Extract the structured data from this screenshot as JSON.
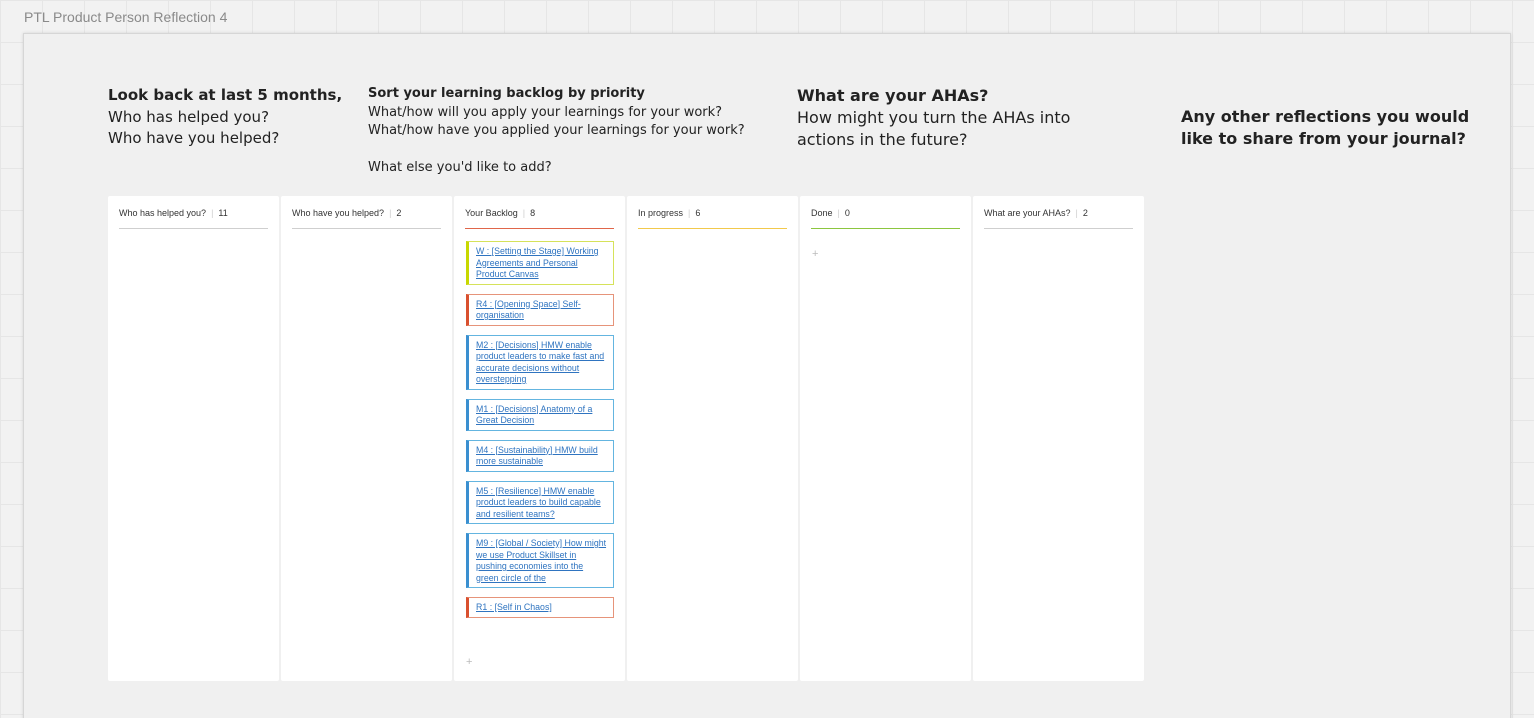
{
  "board": {
    "title": "PTL Product Person Reflection 4"
  },
  "prompts": {
    "p1": {
      "bold": "Look back at last 5 months,",
      "line1": "Who has helped you?",
      "line2": "Who have you helped?"
    },
    "p2": {
      "bold": "Sort your learning backlog by priority",
      "line1": "What/how will you apply your learnings for your work?",
      "line2": "What/how have you applied your learnings for your work?",
      "line3": "What else you'd like to add?"
    },
    "p3": {
      "bold": "What are your AHAs?",
      "line1": "How might you turn the AHAs into",
      "line2": "actions in the future?"
    },
    "p4": {
      "bold1": "Any other reflections you would",
      "bold2": "like to share from your journal?"
    }
  },
  "columns": [
    {
      "title": "Who has helped you?",
      "count": "11"
    },
    {
      "title": "Who have you helped?",
      "count": "2"
    },
    {
      "title": "Your Backlog",
      "count": "8"
    },
    {
      "title": "In progress",
      "count": "6"
    },
    {
      "title": "Done",
      "count": "0"
    },
    {
      "title": "What are your AHAs?",
      "count": "2"
    }
  ],
  "backlog_cards": [
    {
      "text": "W : [Setting the Stage] Working Agreements and Personal Product Canvas",
      "color": "yellow"
    },
    {
      "text": "R4 : [Opening Space] Self-organisation",
      "color": "red"
    },
    {
      "text": "M2 : [Decisions] HMW enable product leaders to make fast and accurate decisions without overstepping",
      "color": "blue"
    },
    {
      "text": "M1 : [Decisions] Anatomy of a Great Decision",
      "color": "blue"
    },
    {
      "text": "M4 : [Sustainability] HMW build more sustainable",
      "color": "blue"
    },
    {
      "text": "M5 : [Resilience] HMW enable product leaders to build capable and resilient teams?",
      "color": "blue"
    },
    {
      "text": "M9 : [Global / Society] How might we use Product Skillset in pushing economies into the green circle of the",
      "color": "blue"
    },
    {
      "text": "R1 : [Self in Chaos]",
      "color": "red"
    }
  ],
  "add_symbol": "+"
}
